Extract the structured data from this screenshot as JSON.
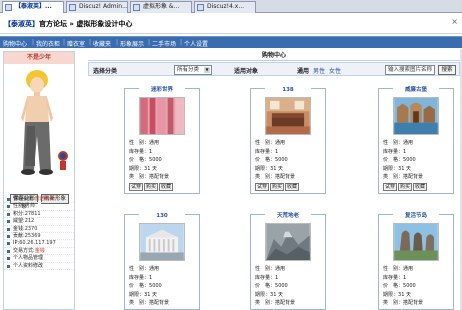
{
  "tabs": [
    {
      "label": "【泰淑英】..."
    },
    {
      "label": "Discuz! Admin..."
    },
    {
      "label": "虚拟形象 &..."
    },
    {
      "label": "Discuz!4.x..."
    }
  ],
  "header": {
    "title_tag": "【泰淑英】",
    "title_text": "官方论坛 » 虚拟形象设计中心",
    "close": "×"
  },
  "nav": [
    {
      "label": "购物中心"
    },
    {
      "label": "我的衣柜"
    },
    {
      "label": "赠衣室"
    },
    {
      "label": "收藏夹"
    },
    {
      "label": "形象展示"
    },
    {
      "label": "二手市场"
    },
    {
      "label": "个人设置"
    }
  ],
  "sidebar": {
    "title": "不是少年",
    "buttons": {
      "save": "保存此形象",
      "refresh": "刷新形象"
    },
    "info": [
      {
        "label": "管理头衔:",
        "value": "普通会员",
        "red": true
      },
      {
        "label": "性别:",
        "value": "男帅",
        "red": false
      },
      {
        "label": "积分:",
        "value": "27811",
        "red": false
      },
      {
        "label": "威望:",
        "value": "212",
        "red": false
      },
      {
        "label": "金钱:",
        "value": "2370",
        "red": false
      },
      {
        "label": "贡献:",
        "value": "25369",
        "red": false
      },
      {
        "label": "IP:",
        "value": "60.26.117.197",
        "red": false
      },
      {
        "label": "交易方式:",
        "value": "金钱",
        "red": true
      },
      {
        "label": "个人物品管理",
        "value": "",
        "red": false
      },
      {
        "label": "个人资料修改",
        "value": "",
        "red": false
      }
    ]
  },
  "main": {
    "title": "购物中心",
    "filter": {
      "category_label": "选择分类",
      "category_value": "所有分类",
      "target_label": "适用对象",
      "usage_label": "通用",
      "male": "男性",
      "female": "女性",
      "search_placeholder": "输入搜索图片名称",
      "search_button": "搜索"
    },
    "cards": [
      {
        "title": "迷彩世界",
        "gender": "通用",
        "stock": "1",
        "price": "5000",
        "term": "31 天",
        "type": "搭配背景"
      },
      {
        "title": "138",
        "gender": "通用",
        "stock": "1",
        "price": "5000",
        "term": "31 天",
        "type": "搭配背景"
      },
      {
        "title": "威廉古堡",
        "gender": "通用",
        "stock": "1",
        "price": "5000",
        "term": "31 天",
        "type": "搭配背景"
      },
      {
        "title": "130",
        "gender": "通用",
        "stock": "1",
        "price": "5000",
        "term": "31 天",
        "type": "搭配背景"
      },
      {
        "title": "天荒地老",
        "gender": "通用",
        "stock": "1",
        "price": "5000",
        "term": "31 天",
        "type": "搭配背景"
      },
      {
        "title": "复活节岛",
        "gender": "通用",
        "stock": "1",
        "price": "5000",
        "term": "31 天",
        "type": "搭配背景"
      }
    ],
    "labels": {
      "gender": "性　别：",
      "stock": "库存量：",
      "price": "价　格：",
      "term": "期限：",
      "type": "类　别："
    },
    "card_buttons": [
      "试穿",
      "购买",
      "收藏"
    ]
  }
}
